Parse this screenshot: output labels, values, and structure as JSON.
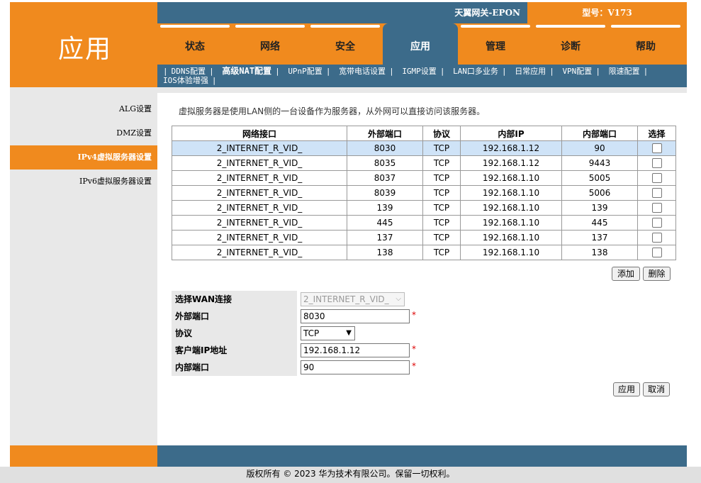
{
  "header": {
    "logo_text": "应用",
    "gateway_name": "天翼网关-EPON",
    "model": "型号：V173"
  },
  "menu": {
    "items": [
      {
        "label": "状态"
      },
      {
        "label": "网络"
      },
      {
        "label": "安全"
      },
      {
        "label": "应用",
        "active": true
      },
      {
        "label": "管理"
      },
      {
        "label": "诊断"
      },
      {
        "label": "帮助"
      }
    ]
  },
  "submenu": {
    "items": [
      "DDNS配置",
      "高级NAT配置",
      "UPnP配置",
      "宽带电话设置",
      "IGMP设置",
      "LAN口多业务",
      "日常应用",
      "VPN配置",
      "限速配置",
      "IOS体验增强"
    ],
    "separator": "|"
  },
  "sidebar": {
    "items": [
      {
        "label": "ALG设置"
      },
      {
        "label": "DMZ设置"
      },
      {
        "label": "IPv4虚拟服务器设置",
        "active": true
      },
      {
        "label": "IPv6虚拟服务器设置"
      }
    ]
  },
  "main": {
    "intro": "虚拟服务器是使用LAN侧的一台设备作为服务器，从外网可以直接访问该服务器。",
    "table": {
      "headers": [
        "网络接口",
        "外部端口",
        "协议",
        "内部IP",
        "内部端口",
        "选择"
      ],
      "rows": [
        [
          "2_INTERNET_R_VID_",
          "8030",
          "TCP",
          "192.168.1.12",
          "90"
        ],
        [
          "2_INTERNET_R_VID_",
          "8035",
          "TCP",
          "192.168.1.12",
          "9443"
        ],
        [
          "2_INTERNET_R_VID_",
          "8037",
          "TCP",
          "192.168.1.10",
          "5005"
        ],
        [
          "2_INTERNET_R_VID_",
          "8039",
          "TCP",
          "192.168.1.10",
          "5006"
        ],
        [
          "2_INTERNET_R_VID_",
          "139",
          "TCP",
          "192.168.1.10",
          "139"
        ],
        [
          "2_INTERNET_R_VID_",
          "445",
          "TCP",
          "192.168.1.10",
          "445"
        ],
        [
          "2_INTERNET_R_VID_",
          "137",
          "TCP",
          "192.168.1.10",
          "137"
        ],
        [
          "2_INTERNET_R_VID_",
          "138",
          "TCP",
          "192.168.1.10",
          "138"
        ]
      ]
    },
    "add_label": "添加",
    "delete_label": "删除",
    "form": {
      "wan_label": "选择WAN连接",
      "wan_value": "2_INTERNET_R_VID_",
      "ext_port_label": "外部端口",
      "ext_port_value": "8030",
      "protocol_label": "协议",
      "protocol_value": "TCP",
      "client_ip_label": "客户端IP地址",
      "client_ip_value": "192.168.1.12",
      "int_port_label": "内部端口",
      "int_port_value": "90",
      "required_mark": "*"
    },
    "apply_label": "应用",
    "cancel_label": "取消"
  },
  "footer": {
    "copyright": "版权所有 © 2023 华为技术有限公司。保留一切权利。"
  },
  "colors": {
    "orange": "#f08a1e",
    "blue": "#3c6b8a",
    "grey": "#e8e8e8",
    "selected_row": "#cfe3f7"
  }
}
